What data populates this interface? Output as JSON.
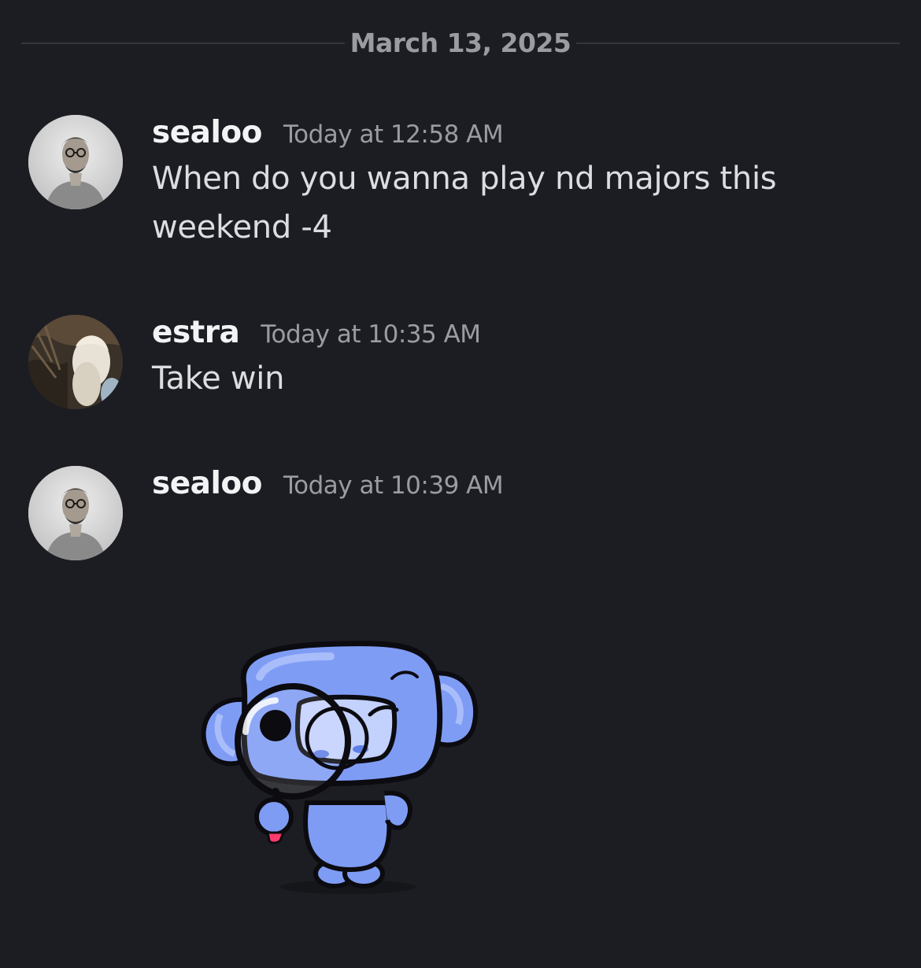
{
  "date_divider": {
    "label": "March 13, 2025"
  },
  "messages": [
    {
      "username": "sealoo",
      "timestamp": "Today at 12:58 AM",
      "text_lines": [
        "When do you wanna play nd majors this",
        "weekend -4"
      ],
      "avatar": "user-photo-avatar"
    },
    {
      "username": "estra",
      "timestamp": "Today at 10:35 AM",
      "text_lines": [
        "Take win"
      ],
      "avatar": "user-photo-avatar"
    },
    {
      "username": "sealoo",
      "timestamp": "Today at 10:39 AM",
      "avatar": "user-photo-avatar",
      "sticker": "wumpus-magnifying-glass-sticker"
    }
  ],
  "colors": {
    "background": "#1c1d22",
    "username": "#f2f3f5",
    "timestamp": "#9a9ca3",
    "message_text": "#dbdee1",
    "divider": "#34363c",
    "wumpus": "#7f9cf5"
  }
}
